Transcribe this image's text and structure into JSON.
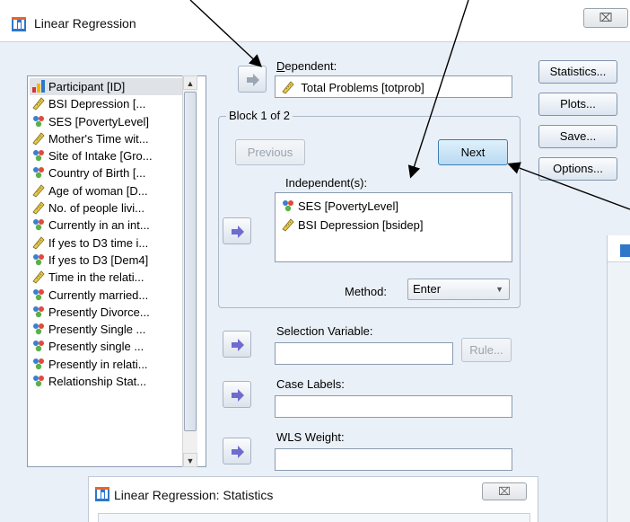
{
  "window": {
    "title": "Linear Regression",
    "close_label": "⌧"
  },
  "variable_list": {
    "items": [
      {
        "label": "Participant [ID]",
        "icon": "nominal-bar-icon",
        "selected": true
      },
      {
        "label": "BSI Depression [...",
        "icon": "scale-ruler-icon"
      },
      {
        "label": "SES [PovertyLevel]",
        "icon": "nominal-people-icon"
      },
      {
        "label": "Mother's Time wit...",
        "icon": "scale-ruler-icon"
      },
      {
        "label": "Site of Intake [Gro...",
        "icon": "nominal-people-icon"
      },
      {
        "label": "Country of Birth [...",
        "icon": "nominal-people-icon"
      },
      {
        "label": "Age of woman [D...",
        "icon": "scale-ruler-icon"
      },
      {
        "label": "No. of people livi...",
        "icon": "scale-ruler-icon"
      },
      {
        "label": "Currently in an int...",
        "icon": "nominal-people-icon"
      },
      {
        "label": "If yes to D3 time i...",
        "icon": "scale-ruler-icon"
      },
      {
        "label": "If yes to D3 [Dem4]",
        "icon": "nominal-people-icon"
      },
      {
        "label": "Time in the relati...",
        "icon": "scale-ruler-icon"
      },
      {
        "label": "Currently married...",
        "icon": "nominal-people-icon"
      },
      {
        "label": "Presently Divorce...",
        "icon": "nominal-people-icon"
      },
      {
        "label": "Presently Single ...",
        "icon": "nominal-people-icon"
      },
      {
        "label": "Presently single ...",
        "icon": "nominal-people-icon"
      },
      {
        "label": "Presently in relati...",
        "icon": "nominal-people-icon"
      },
      {
        "label": "Relationship Stat...",
        "icon": "nominal-people-icon"
      }
    ]
  },
  "dependent": {
    "label": "Dependent:",
    "value": "Total Problems [totprob]"
  },
  "block": {
    "label": "Block 1 of 2",
    "previous": "Previous",
    "next": "Next"
  },
  "independents": {
    "label": "Independent(s):",
    "items": [
      {
        "label": "SES [PovertyLevel]",
        "icon": "nominal-people-icon"
      },
      {
        "label": "BSI Depression [bsidep]",
        "icon": "scale-ruler-icon"
      }
    ]
  },
  "method": {
    "label": "Method:",
    "value": "Enter"
  },
  "selection_variable": {
    "label": "Selection Variable:",
    "value": "",
    "rule_button": "Rule..."
  },
  "case_labels": {
    "label": "Case Labels:",
    "value": ""
  },
  "wls_weight": {
    "label": "WLS Weight:",
    "value": ""
  },
  "side_buttons": {
    "statistics": "Statistics...",
    "plots": "Plots...",
    "save": "Save...",
    "options": "Options..."
  },
  "stats_dialog": {
    "title": "Linear Regression: Statistics",
    "close_label": "⌧"
  },
  "colors": {
    "dialog_bg": "#eaf0f7",
    "arrow_purple": "#6e6ccf",
    "annotation_arrow": "#000000"
  }
}
